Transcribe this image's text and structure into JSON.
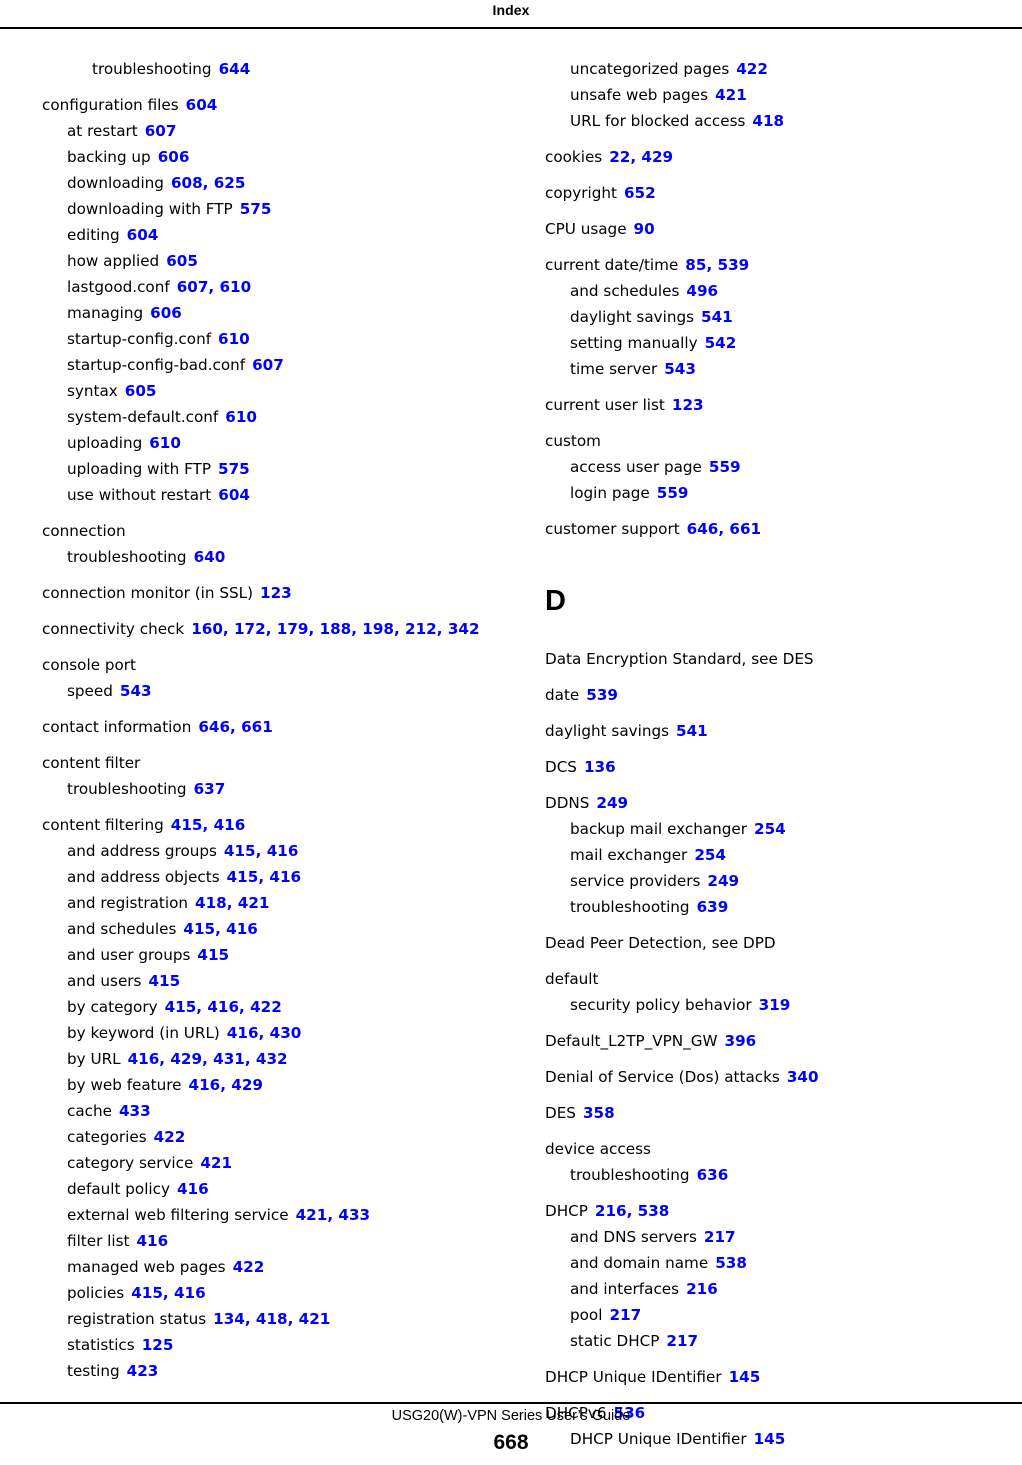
{
  "header": {
    "title": "Index"
  },
  "footer": {
    "guide_title": "USG20(W)-VPN Series User’s Guide",
    "page_number": "668"
  },
  "columns": {
    "left": [
      {
        "level": 2,
        "term": "troubleshooting",
        "pages": "644",
        "gap": false
      },
      {
        "level": 0,
        "term": "configuration files",
        "pages": "604",
        "gap": true
      },
      {
        "level": 1,
        "term": "at restart",
        "pages": "607",
        "gap": false
      },
      {
        "level": 1,
        "term": "backing up",
        "pages": "606",
        "gap": false
      },
      {
        "level": 1,
        "term": "downloading",
        "pages": "608, 625",
        "gap": false
      },
      {
        "level": 1,
        "term": "downloading with FTP",
        "pages": "575",
        "gap": false
      },
      {
        "level": 1,
        "term": "editing",
        "pages": "604",
        "gap": false
      },
      {
        "level": 1,
        "term": "how applied",
        "pages": "605",
        "gap": false
      },
      {
        "level": 1,
        "term": "lastgood.conf",
        "pages": "607, 610",
        "gap": false
      },
      {
        "level": 1,
        "term": "managing",
        "pages": "606",
        "gap": false
      },
      {
        "level": 1,
        "term": "startup-config.conf",
        "pages": "610",
        "gap": false
      },
      {
        "level": 1,
        "term": "startup-config-bad.conf",
        "pages": "607",
        "gap": false
      },
      {
        "level": 1,
        "term": "syntax",
        "pages": "605",
        "gap": false
      },
      {
        "level": 1,
        "term": "system-default.conf",
        "pages": "610",
        "gap": false
      },
      {
        "level": 1,
        "term": "uploading",
        "pages": "610",
        "gap": false
      },
      {
        "level": 1,
        "term": "uploading with FTP",
        "pages": "575",
        "gap": false
      },
      {
        "level": 1,
        "term": "use without restart",
        "pages": "604",
        "gap": false
      },
      {
        "level": 0,
        "term": "connection",
        "pages": "",
        "gap": true
      },
      {
        "level": 1,
        "term": "troubleshooting",
        "pages": "640",
        "gap": false
      },
      {
        "level": 0,
        "term": "connection monitor (in SSL)",
        "pages": "123",
        "gap": true
      },
      {
        "level": 0,
        "term": "connectivity check",
        "pages": "160, 172, 179, 188, 198, 212, 342",
        "gap": true
      },
      {
        "level": 0,
        "term": "console port",
        "pages": "",
        "gap": true
      },
      {
        "level": 1,
        "term": "speed",
        "pages": "543",
        "gap": false
      },
      {
        "level": 0,
        "term": "contact information",
        "pages": "646, 661",
        "gap": true
      },
      {
        "level": 0,
        "term": "content filter",
        "pages": "",
        "gap": true
      },
      {
        "level": 1,
        "term": "troubleshooting",
        "pages": "637",
        "gap": false
      },
      {
        "level": 0,
        "term": "content filtering",
        "pages": "415, 416",
        "gap": true
      },
      {
        "level": 1,
        "term": "and address groups",
        "pages": "415, 416",
        "gap": false
      },
      {
        "level": 1,
        "term": "and address objects",
        "pages": "415, 416",
        "gap": false
      },
      {
        "level": 1,
        "term": "and registration",
        "pages": "418, 421",
        "gap": false
      },
      {
        "level": 1,
        "term": "and schedules",
        "pages": "415, 416",
        "gap": false
      },
      {
        "level": 1,
        "term": "and user groups",
        "pages": "415",
        "gap": false
      },
      {
        "level": 1,
        "term": "and users",
        "pages": "415",
        "gap": false
      },
      {
        "level": 1,
        "term": "by category",
        "pages": "415, 416, 422",
        "gap": false
      },
      {
        "level": 1,
        "term": "by keyword (in URL)",
        "pages": "416, 430",
        "gap": false
      },
      {
        "level": 1,
        "term": "by URL",
        "pages": "416, 429, 431, 432",
        "gap": false
      },
      {
        "level": 1,
        "term": "by web feature",
        "pages": "416, 429",
        "gap": false
      },
      {
        "level": 1,
        "term": "cache",
        "pages": "433",
        "gap": false
      },
      {
        "level": 1,
        "term": "categories",
        "pages": "422",
        "gap": false
      },
      {
        "level": 1,
        "term": "category service",
        "pages": "421",
        "gap": false
      },
      {
        "level": 1,
        "term": "default policy",
        "pages": "416",
        "gap": false
      },
      {
        "level": 1,
        "term": "external web filtering service",
        "pages": "421, 433",
        "gap": false
      },
      {
        "level": 1,
        "term": "filter list",
        "pages": "416",
        "gap": false
      },
      {
        "level": 1,
        "term": "managed web pages",
        "pages": "422",
        "gap": false
      },
      {
        "level": 1,
        "term": "policies",
        "pages": "415, 416",
        "gap": false
      },
      {
        "level": 1,
        "term": "registration status",
        "pages": "134, 418, 421",
        "gap": false
      },
      {
        "level": 1,
        "term": "statistics",
        "pages": "125",
        "gap": false
      },
      {
        "level": 1,
        "term": "testing",
        "pages": "423",
        "gap": false
      }
    ],
    "right_before_letter": [
      {
        "level": 1,
        "term": "uncategorized pages",
        "pages": "422",
        "gap": false
      },
      {
        "level": 1,
        "term": "unsafe web pages",
        "pages": "421",
        "gap": false
      },
      {
        "level": 1,
        "term": "URL for blocked access",
        "pages": "418",
        "gap": false
      },
      {
        "level": 0,
        "term": "cookies",
        "pages": "22, 429",
        "gap": true
      },
      {
        "level": 0,
        "term": "copyright",
        "pages": "652",
        "gap": true
      },
      {
        "level": 0,
        "term": "CPU usage",
        "pages": "90",
        "gap": true
      },
      {
        "level": 0,
        "term": "current date/time",
        "pages": "85, 539",
        "gap": true
      },
      {
        "level": 1,
        "term": "and schedules",
        "pages": "496",
        "gap": false
      },
      {
        "level": 1,
        "term": "daylight savings",
        "pages": "541",
        "gap": false
      },
      {
        "level": 1,
        "term": "setting manually",
        "pages": "542",
        "gap": false
      },
      {
        "level": 1,
        "term": "time server",
        "pages": "543",
        "gap": false
      },
      {
        "level": 0,
        "term": "current user list",
        "pages": "123",
        "gap": true
      },
      {
        "level": 0,
        "term": "custom",
        "pages": "",
        "gap": true
      },
      {
        "level": 1,
        "term": "access user page",
        "pages": "559",
        "gap": false
      },
      {
        "level": 1,
        "term": "login page",
        "pages": "559",
        "gap": false
      },
      {
        "level": 0,
        "term": "customer support",
        "pages": "646, 661",
        "gap": true
      }
    ],
    "section_letter": "D",
    "right_after_letter": [
      {
        "level": 0,
        "term": "Data Encryption Standard, see DES",
        "pages": "",
        "gap": false
      },
      {
        "level": 0,
        "term": "date",
        "pages": "539",
        "gap": true
      },
      {
        "level": 0,
        "term": "daylight savings",
        "pages": "541",
        "gap": true
      },
      {
        "level": 0,
        "term": "DCS",
        "pages": "136",
        "gap": true
      },
      {
        "level": 0,
        "term": "DDNS",
        "pages": "249",
        "gap": true
      },
      {
        "level": 1,
        "term": "backup mail exchanger",
        "pages": "254",
        "gap": false
      },
      {
        "level": 1,
        "term": "mail exchanger",
        "pages": "254",
        "gap": false
      },
      {
        "level": 1,
        "term": "service providers",
        "pages": "249",
        "gap": false
      },
      {
        "level": 1,
        "term": "troubleshooting",
        "pages": "639",
        "gap": false
      },
      {
        "level": 0,
        "term": "Dead Peer Detection, see DPD",
        "pages": "",
        "gap": true
      },
      {
        "level": 0,
        "term": "default",
        "pages": "",
        "gap": true
      },
      {
        "level": 1,
        "term": "security policy behavior",
        "pages": "319",
        "gap": false
      },
      {
        "level": 0,
        "term": "Default_L2TP_VPN_GW",
        "pages": "396",
        "gap": true
      },
      {
        "level": 0,
        "term": "Denial of Service (Dos) attacks",
        "pages": "340",
        "gap": true
      },
      {
        "level": 0,
        "term": "DES",
        "pages": "358",
        "gap": true
      },
      {
        "level": 0,
        "term": "device access",
        "pages": "",
        "gap": true
      },
      {
        "level": 1,
        "term": "troubleshooting",
        "pages": "636",
        "gap": false
      },
      {
        "level": 0,
        "term": "DHCP",
        "pages": "216, 538",
        "gap": true
      },
      {
        "level": 1,
        "term": "and DNS servers",
        "pages": "217",
        "gap": false
      },
      {
        "level": 1,
        "term": "and domain name",
        "pages": "538",
        "gap": false
      },
      {
        "level": 1,
        "term": "and interfaces",
        "pages": "216",
        "gap": false
      },
      {
        "level": 1,
        "term": "pool",
        "pages": "217",
        "gap": false
      },
      {
        "level": 1,
        "term": "static DHCP",
        "pages": "217",
        "gap": false
      },
      {
        "level": 0,
        "term": "DHCP Unique IDentifier",
        "pages": "145",
        "gap": true
      },
      {
        "level": 0,
        "term": "DHCPv6",
        "pages": "536",
        "gap": true
      },
      {
        "level": 1,
        "term": "DHCP Unique IDentifier",
        "pages": "145",
        "gap": false
      }
    ]
  },
  "colors": {
    "page_reference": "#0000ff",
    "text": "#000000",
    "background": "#ffffff"
  }
}
